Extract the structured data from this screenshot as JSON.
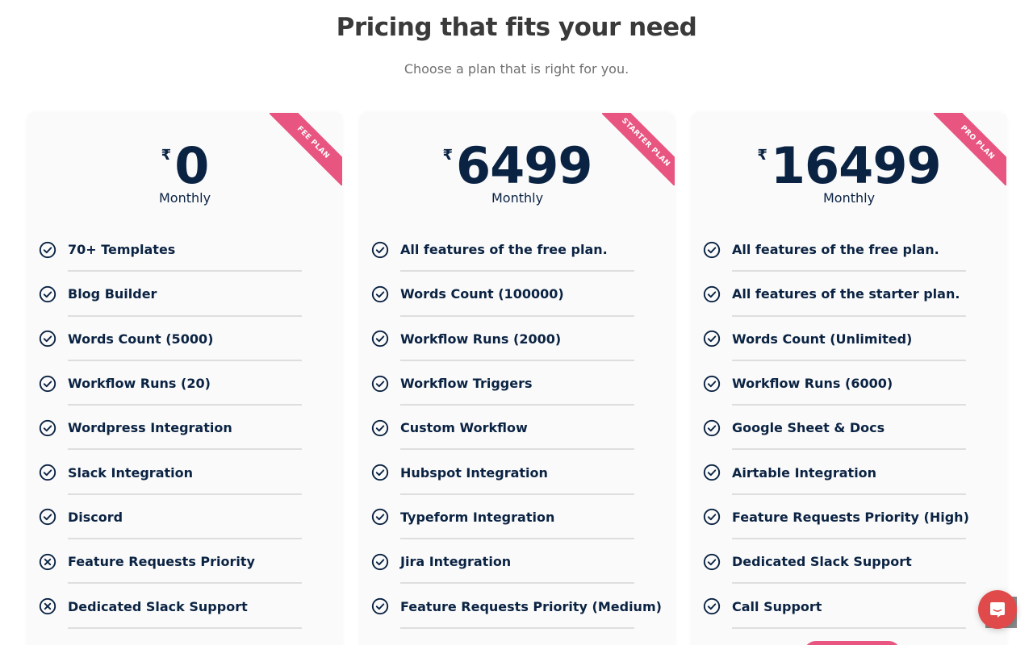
{
  "header": {
    "title": "Pricing that fits your need",
    "subtitle": "Choose a plan that is right for you."
  },
  "colors": {
    "ribbon": "#e85580",
    "text_dark": "#0b2343",
    "card_bg": "#fafafa",
    "chat_button": "#e04a4a"
  },
  "plans": [
    {
      "ribbon": "FEE PLAN",
      "currency": "₹",
      "price": "0",
      "period": "Monthly",
      "features": [
        {
          "label": "70+ Templates",
          "icon": "check-circle-icon"
        },
        {
          "label": "Blog Builder",
          "icon": "check-circle-icon"
        },
        {
          "label": "Words Count (5000)",
          "icon": "check-circle-icon"
        },
        {
          "label": "Workflow Runs (20)",
          "icon": "check-circle-icon"
        },
        {
          "label": "Wordpress Integration",
          "icon": "check-circle-icon"
        },
        {
          "label": "Slack Integration",
          "icon": "check-circle-icon"
        },
        {
          "label": "Discord",
          "icon": "check-circle-icon"
        },
        {
          "label": "Feature Requests Priority",
          "icon": "x-circle-icon"
        },
        {
          "label": "Dedicated Slack Support",
          "icon": "x-circle-icon"
        }
      ]
    },
    {
      "ribbon": "STARTER PLAN",
      "currency": "₹",
      "price": "6499",
      "period": "Monthly",
      "features": [
        {
          "label": "All features of the free plan.",
          "icon": "check-circle-icon"
        },
        {
          "label": "Words Count (100000)",
          "icon": "check-circle-icon"
        },
        {
          "label": "Workflow Runs (2000)",
          "icon": "check-circle-icon"
        },
        {
          "label": "Workflow Triggers",
          "icon": "check-circle-icon"
        },
        {
          "label": "Custom Workflow",
          "icon": "check-circle-icon"
        },
        {
          "label": "Hubspot Integration",
          "icon": "check-circle-icon"
        },
        {
          "label": "Typeform Integration",
          "icon": "check-circle-icon"
        },
        {
          "label": "Jira Integration",
          "icon": "check-circle-icon"
        },
        {
          "label": "Feature Requests Priority (Medium)",
          "icon": "check-circle-icon"
        }
      ]
    },
    {
      "ribbon": "PRO PLAN",
      "currency": "₹",
      "price": "16499",
      "period": "Monthly",
      "features": [
        {
          "label": "All features of the free plan.",
          "icon": "check-circle-icon"
        },
        {
          "label": "All features of the starter plan.",
          "icon": "check-circle-icon"
        },
        {
          "label": "Words Count (Unlimited)",
          "icon": "check-circle-icon"
        },
        {
          "label": "Workflow Runs (6000)",
          "icon": "check-circle-icon"
        },
        {
          "label": "Google Sheet & Docs",
          "icon": "check-circle-icon"
        },
        {
          "label": "Airtable Integration",
          "icon": "check-circle-icon"
        },
        {
          "label": "Feature Requests Priority (High)",
          "icon": "check-circle-icon"
        },
        {
          "label": "Dedicated Slack Support",
          "icon": "check-circle-icon"
        },
        {
          "label": "Call Support",
          "icon": "check-circle-icon"
        }
      ]
    }
  ],
  "widgets": {
    "chat_icon": "chat-bubble-icon",
    "scroll_top_icon": "scroll-top-icon"
  }
}
